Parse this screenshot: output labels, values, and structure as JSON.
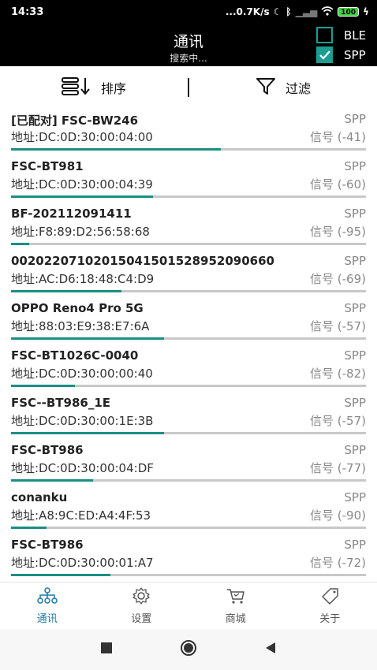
{
  "status_bar": {
    "time": "14:33",
    "net_speed": "...0.7K/s",
    "battery": "100"
  },
  "header": {
    "title": "通讯",
    "subtitle": "搜索中...",
    "ble_label": "BLE",
    "ble_checked": false,
    "spp_label": "SPP",
    "spp_checked": true
  },
  "toolbar": {
    "sort_label": "排序",
    "filter_label": "过滤"
  },
  "devices": [
    {
      "name": "[已配对] FSC-BW246",
      "type": "SPP",
      "address": "地址:DC:0D:30:00:04:00",
      "rssi": "信号 (-41)",
      "strength": 0.59
    },
    {
      "name": "FSC-BT981",
      "type": "SPP",
      "address": "地址:DC:0D:30:00:04:39",
      "rssi": "信号 (-60)",
      "strength": 0.4
    },
    {
      "name": "BF-202112091411",
      "type": "SPP",
      "address": "地址:F8:89:D2:56:58:68",
      "rssi": "信号 (-95)",
      "strength": 0.05
    },
    {
      "name": "00202207102015041501528952090660",
      "type": "SPP",
      "address": "地址:AC:D6:18:48:C4:D9",
      "rssi": "信号 (-69)",
      "strength": 0.31
    },
    {
      "name": "OPPO Reno4 Pro 5G",
      "type": "SPP",
      "address": "地址:88:03:E9:38:E7:6A",
      "rssi": "信号 (-57)",
      "strength": 0.43
    },
    {
      "name": "FSC-BT1026C-0040",
      "type": "SPP",
      "address": "地址:DC:0D:30:00:00:40",
      "rssi": "信号 (-82)",
      "strength": 0.18
    },
    {
      "name": "FSC--BT986_1E",
      "type": "SPP",
      "address": "地址:DC:0D:30:00:1E:3B",
      "rssi": "信号 (-57)",
      "strength": 0.43
    },
    {
      "name": "FSC-BT986",
      "type": "SPP",
      "address": "地址:DC:0D:30:00:04:DF",
      "rssi": "信号 (-77)",
      "strength": 0.23
    },
    {
      "name": "conanku",
      "type": "SPP",
      "address": "地址:A8:9C:ED:A4:4F:53",
      "rssi": "信号 (-90)",
      "strength": 0.1
    },
    {
      "name": "FSC-BT986",
      "type": "SPP",
      "address": "地址:DC:0D:30:00:01:A7",
      "rssi": "信号 (-72)",
      "strength": 0.28
    }
  ],
  "bottom_nav": [
    {
      "label": "通讯",
      "icon": "network-icon",
      "active": true
    },
    {
      "label": "设置",
      "icon": "gear-icon",
      "active": false
    },
    {
      "label": "商城",
      "icon": "cart-icon",
      "active": false
    },
    {
      "label": "关于",
      "icon": "tag-icon",
      "active": false
    }
  ],
  "colors": {
    "accent": "#1a8f84",
    "nav_active": "#1a7aa8",
    "header_bg": "#000000"
  }
}
